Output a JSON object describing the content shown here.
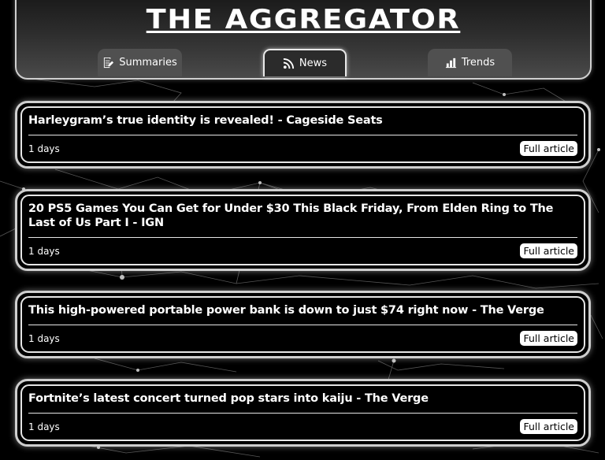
{
  "app": {
    "title": "THE AGGREGATOR"
  },
  "tabs": [
    {
      "label": "Summaries",
      "icon": "summaries-icon"
    },
    {
      "label": "News",
      "icon": "rss-icon",
      "active": true
    },
    {
      "label": "Trends",
      "icon": "bar-chart-icon"
    }
  ],
  "articles": [
    {
      "headline": "Harleygram’s true identity is revealed! - Cageside Seats",
      "age": "1 days",
      "button": "Full article"
    },
    {
      "headline": "20 PS5 Games You Can Get for Under $30 This Black Friday, From Elden Ring to The Last of Us Part I - IGN",
      "age": "1 days",
      "button": "Full article"
    },
    {
      "headline": "This high-powered portable power bank is down to just $74 right now - The Verge",
      "age": "1 days",
      "button": "Full article"
    },
    {
      "headline": "Fortnite’s latest concert turned pop stars into kaiju - The Verge",
      "age": "1 days",
      "button": "Full article"
    }
  ],
  "colors": {
    "background": "#000000",
    "accent": "#ffffff",
    "tab": "#505050"
  }
}
